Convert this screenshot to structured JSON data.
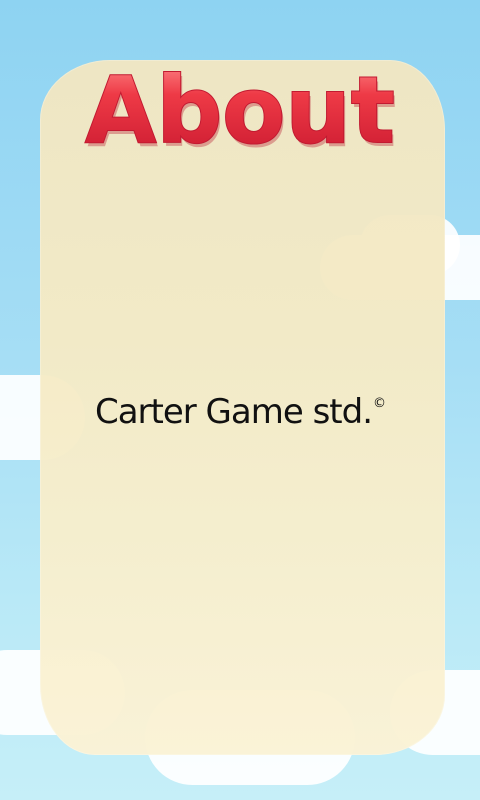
{
  "screen": {
    "title": "About",
    "credit_text": "Carter Game std.",
    "copyright_symbol": "©"
  },
  "colors": {
    "sky_top": "#8ed3f2",
    "sky_bottom": "#c6eff8",
    "panel": "#f5ebc6",
    "title_fill": "#ee3a46",
    "title_highlight": "#ff8d8d",
    "title_shadow": "#b8172d",
    "text": "#111111"
  }
}
